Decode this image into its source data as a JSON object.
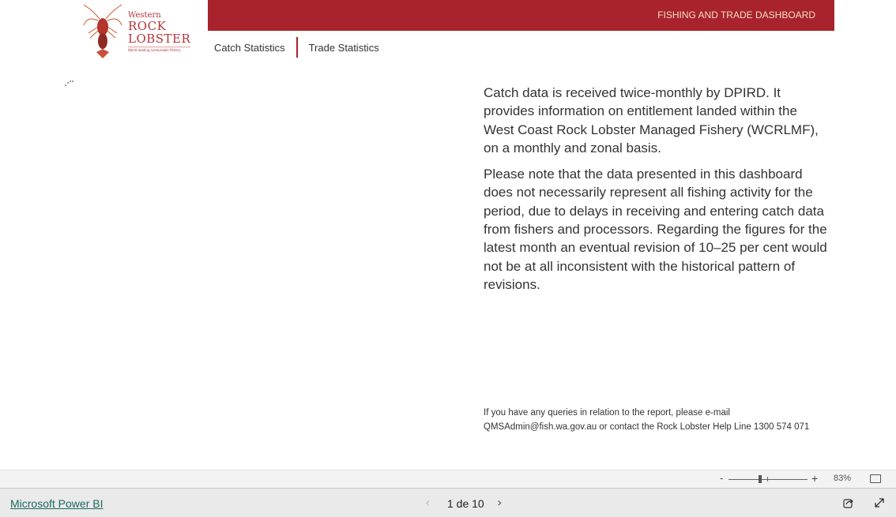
{
  "logo": {
    "western": "Western",
    "rock": "ROCK",
    "lobster": "LOBSTER",
    "tagline": "World leading sustainable fishery"
  },
  "banner": {
    "title": "FISHING AND TRADE DASHBOARD",
    "color": "#a8232b"
  },
  "nav": {
    "items": [
      {
        "label": "Catch Statistics"
      },
      {
        "label": "Trade Statistics"
      }
    ]
  },
  "info": {
    "paragraphs": [
      "Catch data is received twice-monthly by DPIRD. It provides information on entitlement landed within the West Coast Rock Lobster Managed Fishery (WCRLMF), on a monthly and zonal basis.",
      "Please note that the data presented in this dashboard does not necessarily represent all fishing activity for the period, due to delays in receiving and entering catch data from fishers and processors. Regarding the figures for the latest month an eventual revision of 10–25 per cent would not be at all inconsistent with the historical pattern of revisions."
    ]
  },
  "contact": {
    "line1": "If you have any queries in relation to the report, please e-mail",
    "line2": "QMSAdmin@fish.wa.gov.au or contact the Rock Lobster Help Line 1300 574 071"
  },
  "zoombar": {
    "minus": "-",
    "plus": "+",
    "zoom_level": "83%"
  },
  "footer": {
    "brand_link": "Microsoft Power BI",
    "prev": "‹",
    "page_indicator": "1 de 10",
    "next": "›"
  }
}
